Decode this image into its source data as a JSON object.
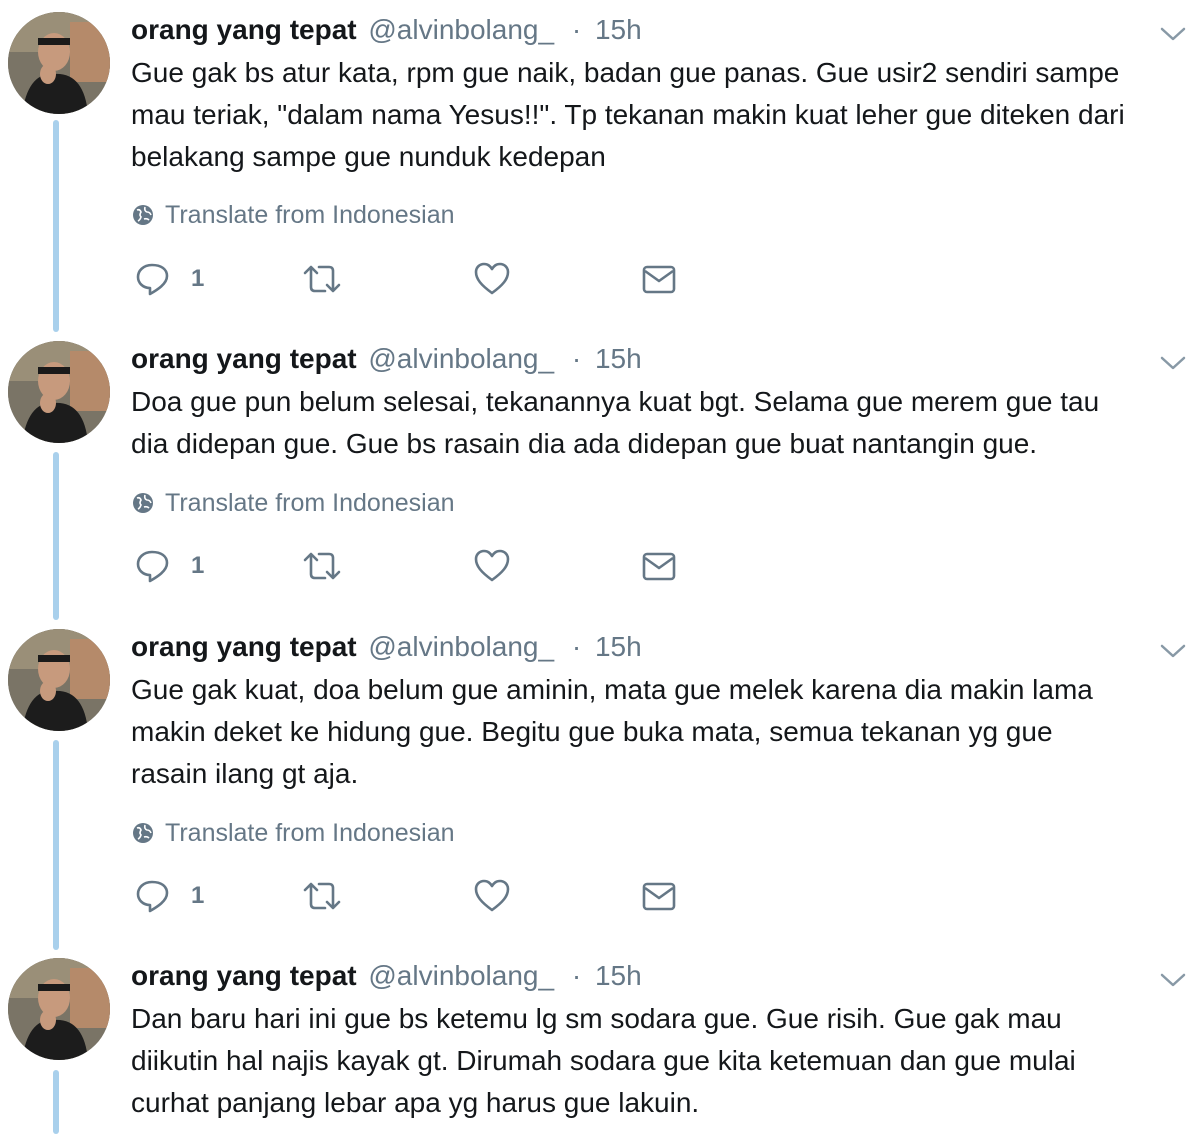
{
  "colors": {
    "thread_line": "#a9d0ec",
    "secondary_text": "#657786",
    "primary_text": "#14171a"
  },
  "icons": {
    "reply": "reply-icon",
    "retweet": "retweet-icon",
    "like": "heart-icon",
    "dm": "envelope-icon",
    "translate": "globe-icon",
    "menu": "chevron-down-icon"
  },
  "tweets": [
    {
      "name": "orang yang tepat",
      "handle": "@alvinbolang_",
      "separator": "·",
      "time": "15h",
      "text": "Gue gak bs atur kata, rpm gue naik, badan gue panas. Gue usir2 sendiri sampe\nmau teriak, \"dalam nama Yesus!!\". Tp tekanan makin kuat leher gue diteken dari\nbelakang sampe gue nunduk kedepan",
      "translate": "Translate from Indonesian",
      "reply_count": "1"
    },
    {
      "name": "orang yang tepat",
      "handle": "@alvinbolang_",
      "separator": "·",
      "time": "15h",
      "text": "Doa gue pun belum selesai, tekanannya kuat bgt. Selama gue merem gue tau\ndia didepan gue. Gue bs rasain dia ada didepan gue buat nantangin gue.",
      "translate": "Translate from Indonesian",
      "reply_count": "1"
    },
    {
      "name": "orang yang tepat",
      "handle": "@alvinbolang_",
      "separator": "·",
      "time": "15h",
      "text": "Gue gak kuat, doa belum gue aminin, mata gue melek karena dia makin lama\nmakin deket ke hidung gue. Begitu gue buka mata, semua tekanan yg gue\nrasain ilang gt aja.",
      "translate": "Translate from Indonesian",
      "reply_count": "1"
    },
    {
      "name": "orang yang tepat",
      "handle": "@alvinbolang_",
      "separator": "·",
      "time": "15h",
      "text": "Dan baru hari ini gue bs ketemu lg sm sodara gue. Gue risih. Gue gak mau\ndiikutin hal najis kayak gt. Dirumah sodara gue kita ketemuan dan gue mulai\ncurhat panjang lebar apa yg harus gue lakuin."
    }
  ]
}
